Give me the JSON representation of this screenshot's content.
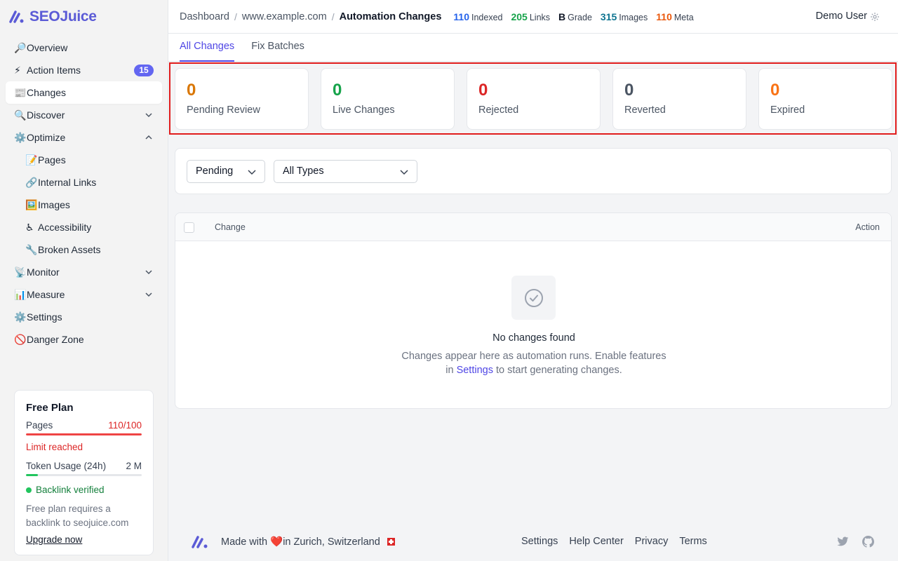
{
  "app": {
    "brand": "SEOJuice"
  },
  "sidebar": {
    "items": [
      {
        "emoji": "🔎",
        "label": "Overview"
      },
      {
        "emoji": "⚡",
        "label": "Action Items",
        "badge": "15"
      },
      {
        "emoji": "📰",
        "label": "Changes"
      },
      {
        "emoji": "🔍",
        "label": "Discover"
      },
      {
        "emoji": "⚙️",
        "label": "Optimize"
      },
      {
        "emoji": "📝",
        "label": "Pages"
      },
      {
        "emoji": "🔗",
        "label": "Internal Links"
      },
      {
        "emoji": "🖼️",
        "label": "Images"
      },
      {
        "emoji": "♿",
        "label": "Accessibility"
      },
      {
        "emoji": "🔧",
        "label": "Broken Assets"
      },
      {
        "emoji": "📡",
        "label": "Monitor"
      },
      {
        "emoji": "📊",
        "label": "Measure"
      },
      {
        "emoji": "⚙️",
        "label": "Settings"
      },
      {
        "emoji": "🚫",
        "label": "Danger Zone"
      }
    ]
  },
  "plan": {
    "title": "Free Plan",
    "pages_label": "Pages",
    "pages_value": "110/100",
    "pages_progress": 1.0,
    "limit_text": "Limit reached",
    "token_label": "Token Usage (24h)",
    "token_value": "2 M",
    "token_progress": 0.1,
    "verified_text": "Backlink verified",
    "note": "Free plan requires a backlink to seojuice.com",
    "upgrade": "Upgrade now"
  },
  "header": {
    "crumb_1": "Dashboard",
    "crumb_2": "www.example.com",
    "crumb_current": "Automation Changes",
    "stats": [
      {
        "value": "110",
        "label": "Indexed",
        "color": "#2563eb"
      },
      {
        "value": "205",
        "label": "Links",
        "color": "#16a34a"
      },
      {
        "value": "B",
        "label": "Grade",
        "color": "#111827"
      },
      {
        "value": "315",
        "label": "Images",
        "color": "#0e7490"
      },
      {
        "value": "110",
        "label": "Meta",
        "color": "#ea580c"
      }
    ],
    "user": "Demo User"
  },
  "tabs": {
    "all": "All Changes",
    "batches": "Fix Batches"
  },
  "cards": [
    {
      "value": "0",
      "label": "Pending Review",
      "color": "#d97706"
    },
    {
      "value": "0",
      "label": "Live Changes",
      "color": "#16a34a"
    },
    {
      "value": "0",
      "label": "Rejected",
      "color": "#dc2626"
    },
    {
      "value": "0",
      "label": "Reverted",
      "color": "#4b5563"
    },
    {
      "value": "0",
      "label": "Expired",
      "color": "#f97316"
    }
  ],
  "filters": {
    "status": "Pending",
    "type": "All Types"
  },
  "table": {
    "col_change": "Change",
    "col_action": "Action",
    "empty_title": "No changes found",
    "empty_sub_1": "Changes appear here as automation runs. Enable features",
    "empty_sub_2a": "in",
    "empty_sub_link": "Settings",
    "empty_sub_2b": "to start generating changes."
  },
  "footer": {
    "made_prefix": "Made with",
    "made_suffix": "in Zurich, Switzerland",
    "links": [
      "Settings",
      "Help Center",
      "Privacy",
      "Terms"
    ]
  }
}
